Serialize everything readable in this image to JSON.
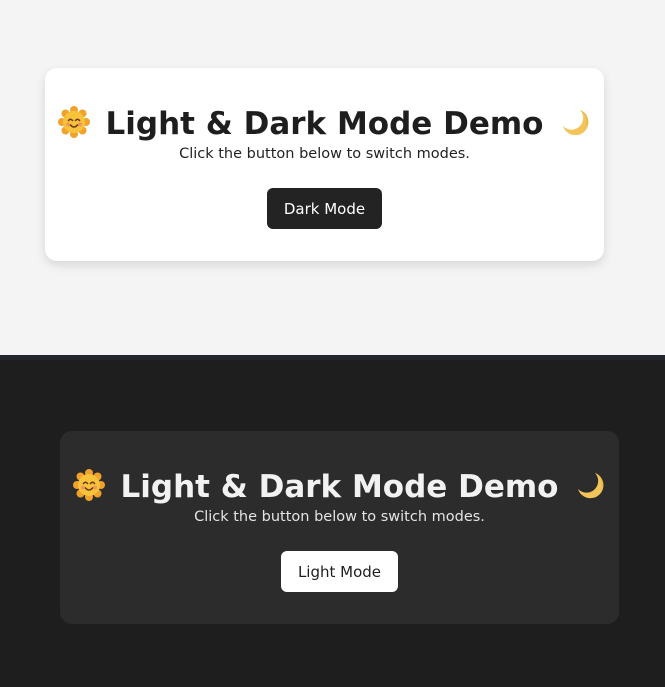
{
  "light_panel": {
    "title": "Light & Dark Mode Demo",
    "subtitle": "Click the button below to switch modes.",
    "button_label": "Dark Mode"
  },
  "dark_panel": {
    "title": "Light & Dark Mode Demo",
    "subtitle": "Click the button below to switch modes.",
    "button_label": "Light Mode"
  },
  "icons": {
    "leading": "smiling-sun-icon",
    "trailing": "crescent-moon-icon"
  },
  "colors": {
    "light_background": "#f4f4f4",
    "light_card": "#ffffff",
    "dark_background": "#1e1e1e",
    "dark_card": "#2c2c2c",
    "dark_button": "#232323",
    "light_button": "#ffffff"
  }
}
